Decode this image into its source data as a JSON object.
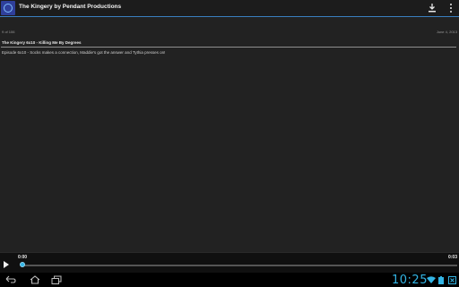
{
  "app": {
    "title": "The Kingery by Pendant Productions",
    "icons": {
      "app": "app-logo-icon",
      "download": "download-icon",
      "menu": "overflow-menu-icon"
    }
  },
  "episode": {
    "index_text": "9 of 106",
    "date": "June 4, 2013",
    "title": "The Kingery 6x10 - Killing Me By Degrees",
    "description": "Episode 6x10 - Socks makes a connection, Maddie's got the answer and Tythia presses on!"
  },
  "player": {
    "elapsed": "0:00",
    "duration": "0:03",
    "progress_fraction": 0.0,
    "icons": {
      "play": "play-icon"
    },
    "accent_color": "#33b5e5"
  },
  "system": {
    "clock": "10:25",
    "icons": {
      "back": "back-icon",
      "home": "home-icon",
      "recent": "recent-apps-icon",
      "wifi": "wifi-icon",
      "battery": "battery-icon",
      "notification": "notification-icon"
    }
  }
}
